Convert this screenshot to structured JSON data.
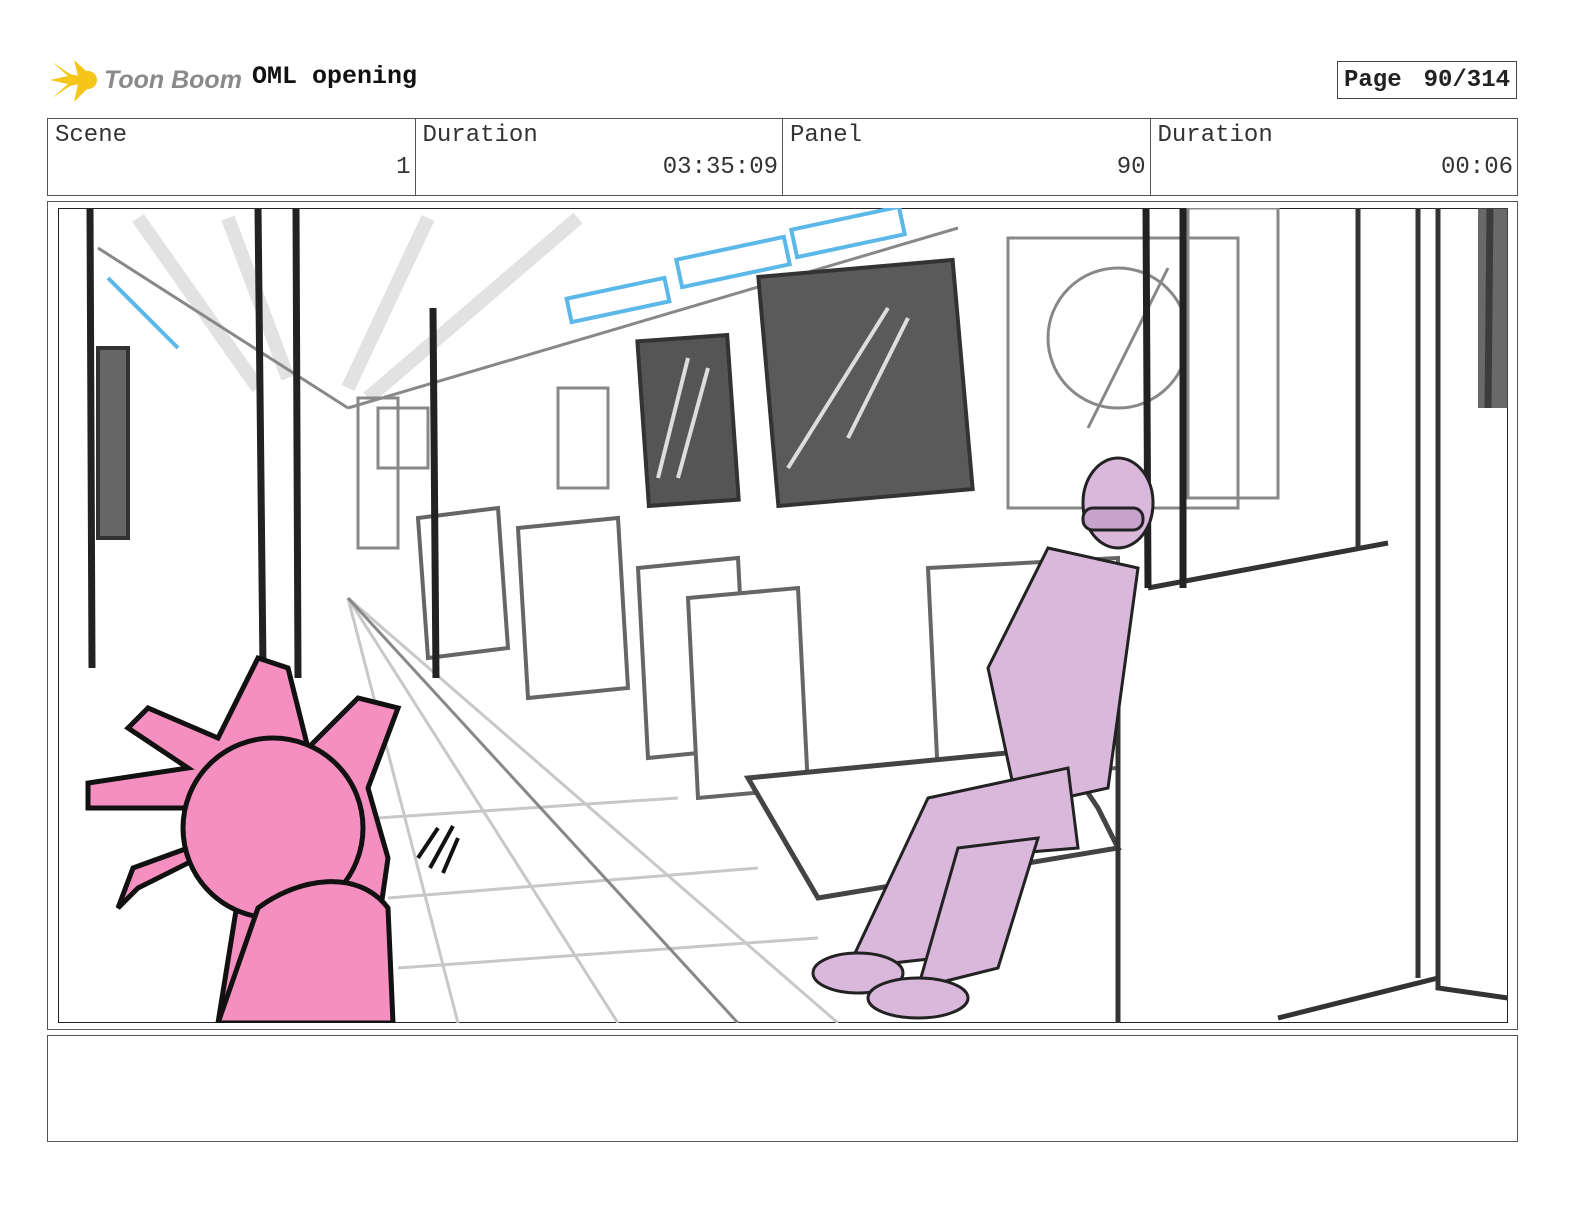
{
  "header": {
    "logo_text": "Toon Boom",
    "project_title": "OML opening",
    "page_label": "Page",
    "page_value": "90/314"
  },
  "info": {
    "scene_label": "Scene",
    "scene_value": "1",
    "scene_duration_label": "Duration",
    "scene_duration_value": "03:35:09",
    "panel_label": "Panel",
    "panel_value": "90",
    "panel_duration_label": "Duration",
    "panel_duration_value": "00:06"
  },
  "panel_image": {
    "description_colors": {
      "hand": "#f48fbf",
      "figure": "#d9b8dc",
      "lights": "#5bb8e8",
      "sketch": "#333333"
    }
  },
  "notes": {
    "text": ""
  }
}
